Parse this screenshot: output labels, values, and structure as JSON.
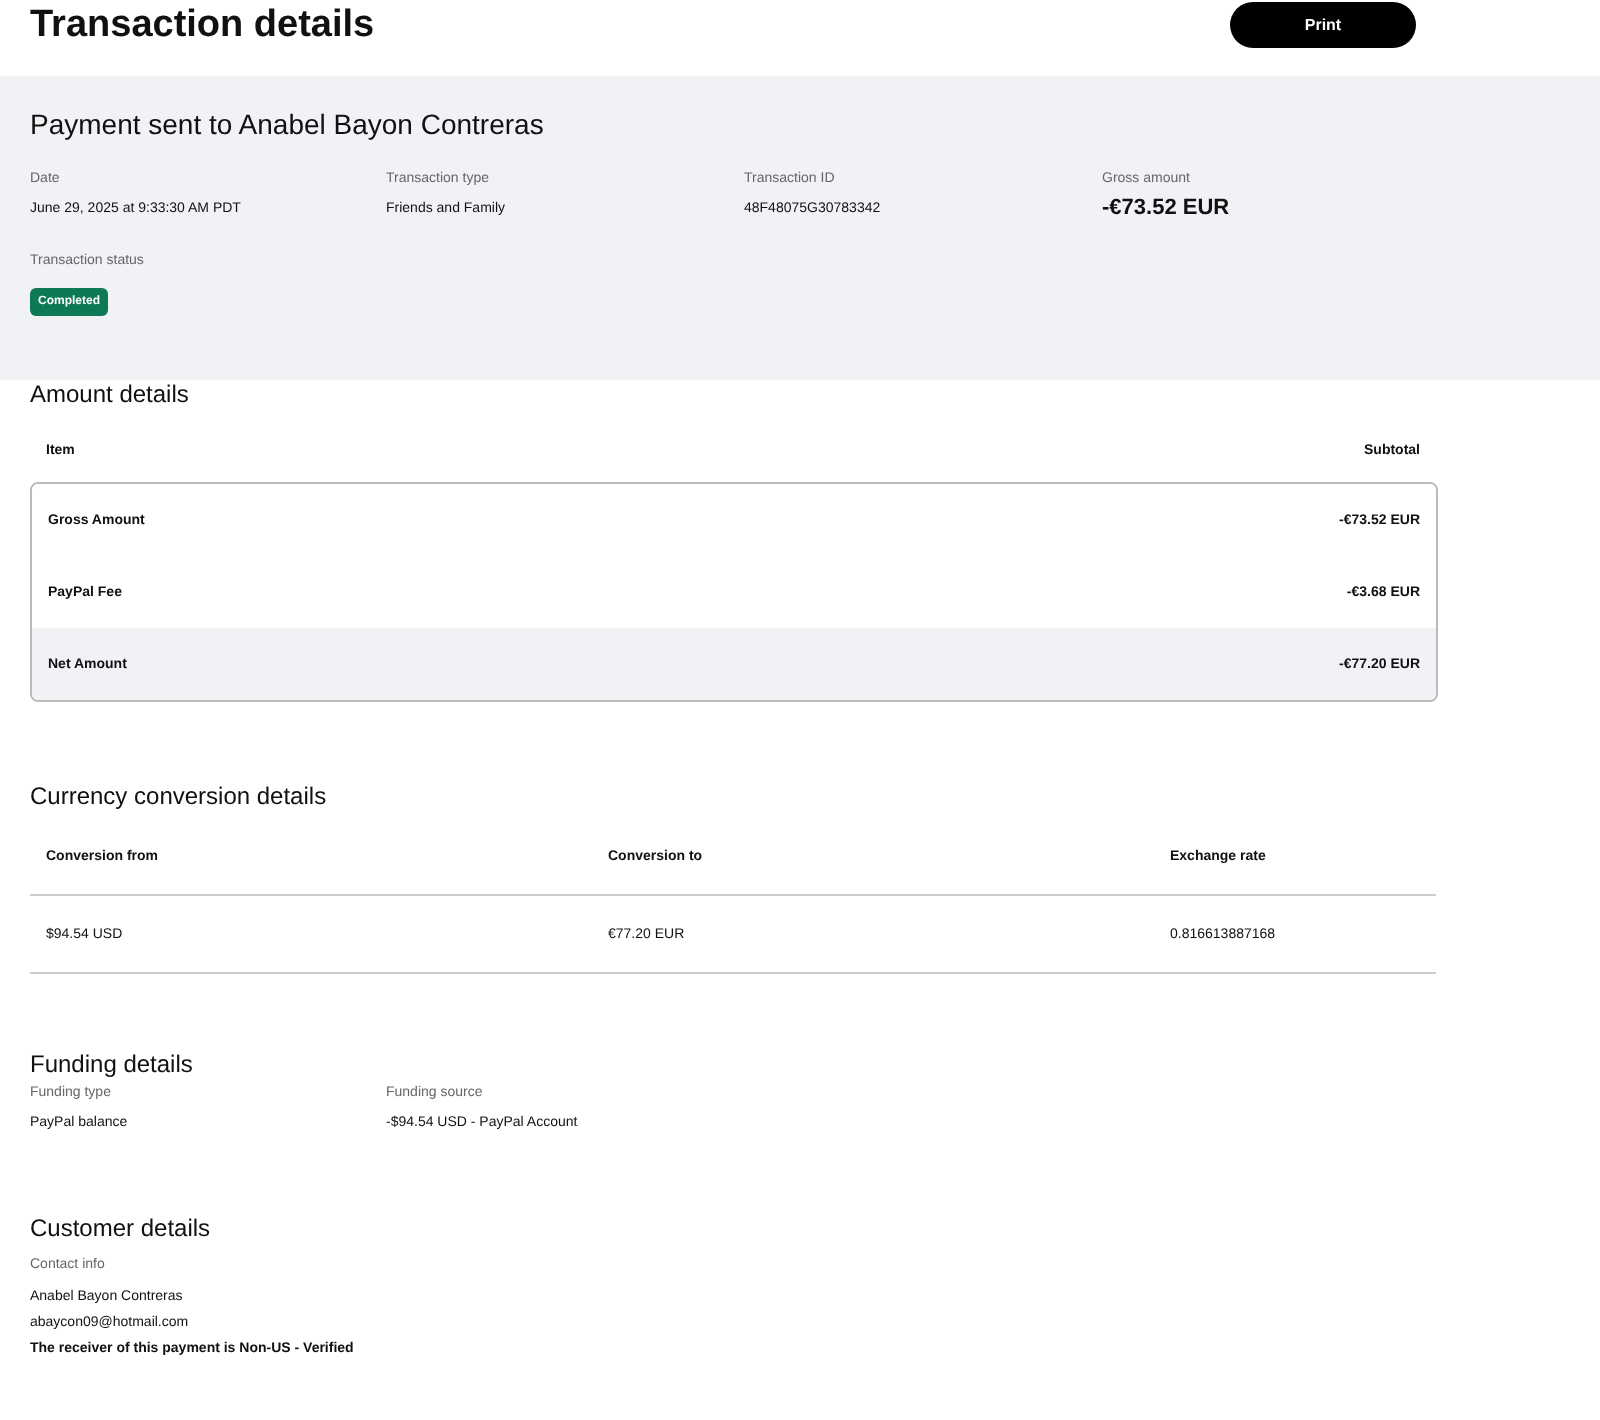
{
  "header": {
    "title": "Transaction details",
    "print_button": "Print"
  },
  "summary": {
    "title": "Payment sent to Anabel Bayon Contreras",
    "fields": [
      {
        "label": "Date",
        "value": "June 29, 2025 at 9:33:30 AM PDT",
        "kind": "text"
      },
      {
        "label": "Transaction type",
        "value": "Friends and Family",
        "kind": "text"
      },
      {
        "label": "Transaction ID",
        "value": "48F48075G30783342",
        "kind": "text"
      },
      {
        "label": "Gross amount",
        "value": "-€73.52 EUR",
        "kind": "amount"
      }
    ],
    "status": {
      "label": "Transaction status",
      "value": "Completed"
    }
  },
  "amount_details": {
    "title": "Amount details",
    "columns": [
      "Item",
      "Subtotal"
    ],
    "rows": [
      {
        "item": "Gross Amount",
        "subtotal": "-€73.52 EUR",
        "highlighted": false
      },
      {
        "item": "PayPal Fee",
        "subtotal": "-€3.68 EUR",
        "highlighted": false
      },
      {
        "item": "Net Amount",
        "subtotal": "-€77.20 EUR",
        "highlighted": true
      }
    ]
  },
  "currency_conversion": {
    "title": "Currency conversion details",
    "columns": [
      "Conversion from",
      "Conversion to",
      "Exchange rate"
    ],
    "rows": [
      [
        "$94.54 USD",
        "€77.20 EUR",
        "0.816613887168"
      ]
    ]
  },
  "funding_details": {
    "title": "Funding details",
    "fields": [
      {
        "label": "Funding type",
        "value": "PayPal balance"
      },
      {
        "label": "Funding source",
        "value": "-$94.54 USD - PayPal Account"
      }
    ]
  },
  "customer_details": {
    "title": "Customer details",
    "label": "Contact info",
    "lines": [
      {
        "text": "Anabel Bayon Contreras",
        "strong": false
      },
      {
        "text": "abaycon09@hotmail.com",
        "strong": false
      },
      {
        "text": "The receiver of this payment is Non-US - Verified",
        "strong": true
      }
    ]
  }
}
